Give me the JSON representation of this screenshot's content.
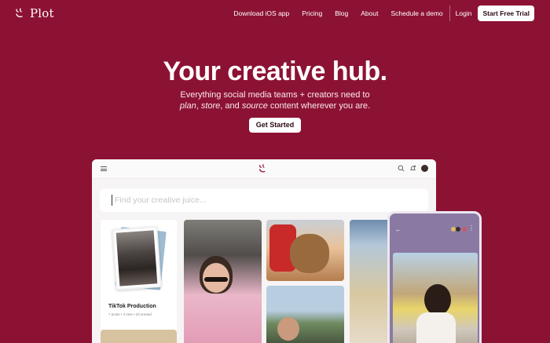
{
  "brand": {
    "name": "Plot"
  },
  "nav": {
    "links": [
      "Download iOS app",
      "Pricing",
      "Blog",
      "About",
      "Schedule a demo"
    ],
    "login": "Login",
    "trial": "Start Free Trial"
  },
  "hero": {
    "title": "Your creative hub.",
    "subtitle_line1": "Everything social media teams + creators need to",
    "word_plan": "plan",
    "sep1": ", ",
    "word_store": "store",
    "sep2": ", and ",
    "word_source": "source",
    "subtitle_tail": " content wherever you are.",
    "cta": "Get Started"
  },
  "app": {
    "search": {
      "placeholder": "Find your creative juice..."
    },
    "folder": {
      "title": "TikTok Production",
      "meta": "7 posts • 4 new • 23 unread"
    }
  },
  "colors": {
    "background": "#8c1233",
    "button_bg": "#ffffff",
    "phone": "#8a7aa3"
  },
  "icons": [
    "plot-logo-icon",
    "menu-icon",
    "search-icon",
    "bell-icon",
    "back-arrow-icon",
    "more-icon"
  ]
}
